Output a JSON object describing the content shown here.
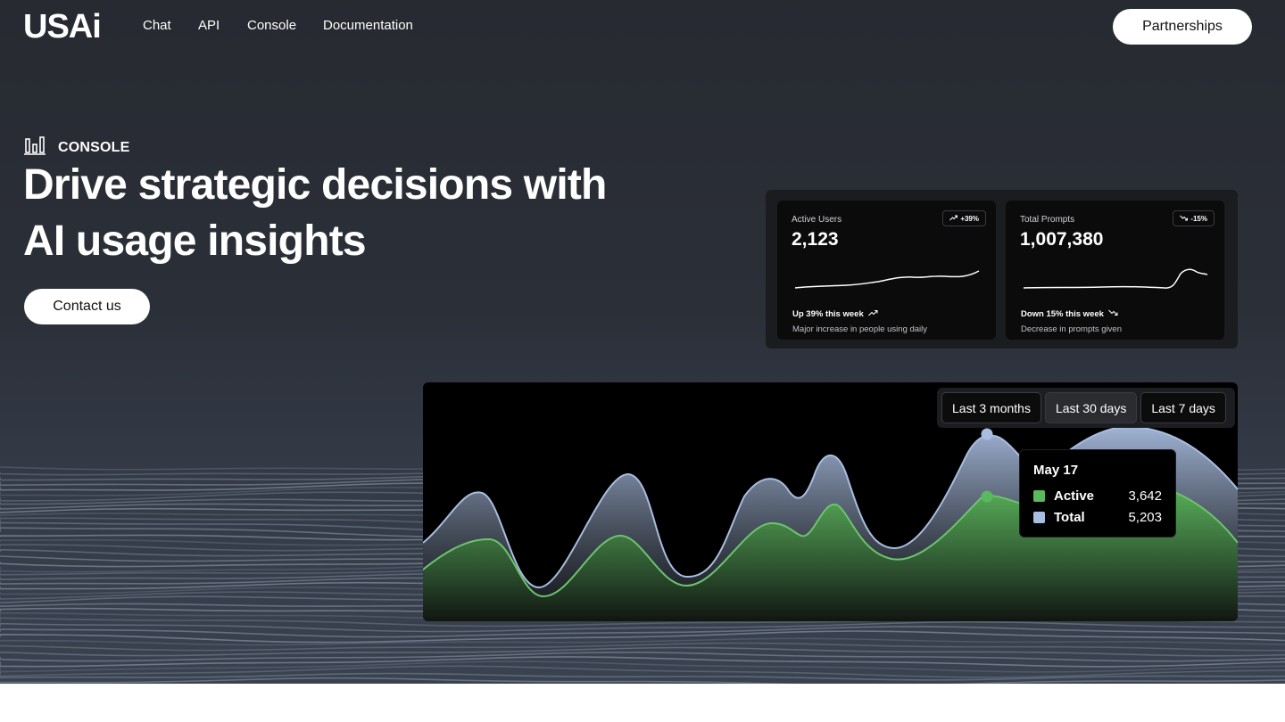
{
  "nav": {
    "logo": "USAi",
    "links": [
      "Chat",
      "API",
      "Console",
      "Documentation"
    ],
    "cta": "Partnerships"
  },
  "hero": {
    "eyebrow_icon": "bar-chart-icon",
    "eyebrow": "CONSOLE",
    "headline": "Drive strategic decisions with AI usage insights",
    "cta": "Contact us"
  },
  "stats": [
    {
      "label": "Active Users",
      "value": "2,123",
      "badge": "+39%",
      "badge_icon": "trend-up-icon",
      "trend": "Up 39% this week",
      "trend_icon": "trend-up-icon",
      "description": "Major increase in people using daily"
    },
    {
      "label": "Total Prompts",
      "value": "1,007,380",
      "badge": "-15%",
      "badge_icon": "trend-down-icon",
      "trend": "Down 15% this week",
      "trend_icon": "trend-down-icon",
      "description": "Decrease in prompts given"
    }
  ],
  "usage_chart": {
    "ranges": [
      "Last 3 months",
      "Last 30 days",
      "Last 7 days"
    ],
    "selected_range": "Last 30 days",
    "tooltip": {
      "date": "May 17",
      "rows": [
        {
          "name": "Active",
          "value": "3,642",
          "color": "#5cb85c"
        },
        {
          "name": "Total",
          "value": "5,203",
          "color": "#a9bde0"
        }
      ]
    }
  },
  "colors": {
    "hero_bg": "#2a2d35",
    "active_series": "#5cb85c",
    "total_series": "#a9bde0",
    "button_bg": "#ffffff"
  }
}
